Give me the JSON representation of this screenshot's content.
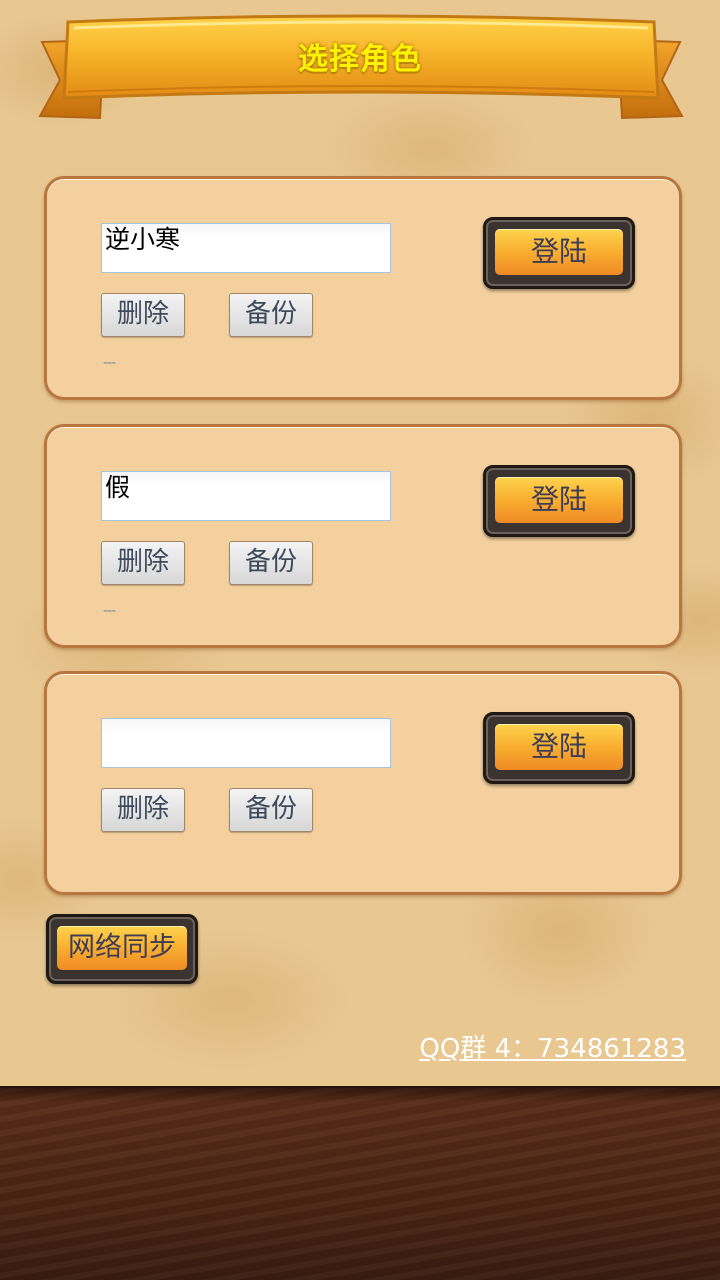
{
  "header": {
    "title": "选择角色"
  },
  "slots": [
    {
      "name": "逆小寒",
      "delete_label": "删除",
      "backup_label": "备份",
      "status": "---",
      "login_label": "登陆"
    },
    {
      "name": "假",
      "delete_label": "删除",
      "backup_label": "备份",
      "status": "---",
      "login_label": "登陆"
    },
    {
      "name": "",
      "delete_label": "删除",
      "backup_label": "备份",
      "status": "",
      "login_label": "登陆"
    }
  ],
  "sync_label": "网络同步",
  "qq_group": "QQ群 4：734861283",
  "colors": {
    "title": "#fff200",
    "panel": "#f4d09e",
    "panel_border": "#b9773f",
    "button_orange": "#f9b232",
    "wood": "#4a2414"
  }
}
